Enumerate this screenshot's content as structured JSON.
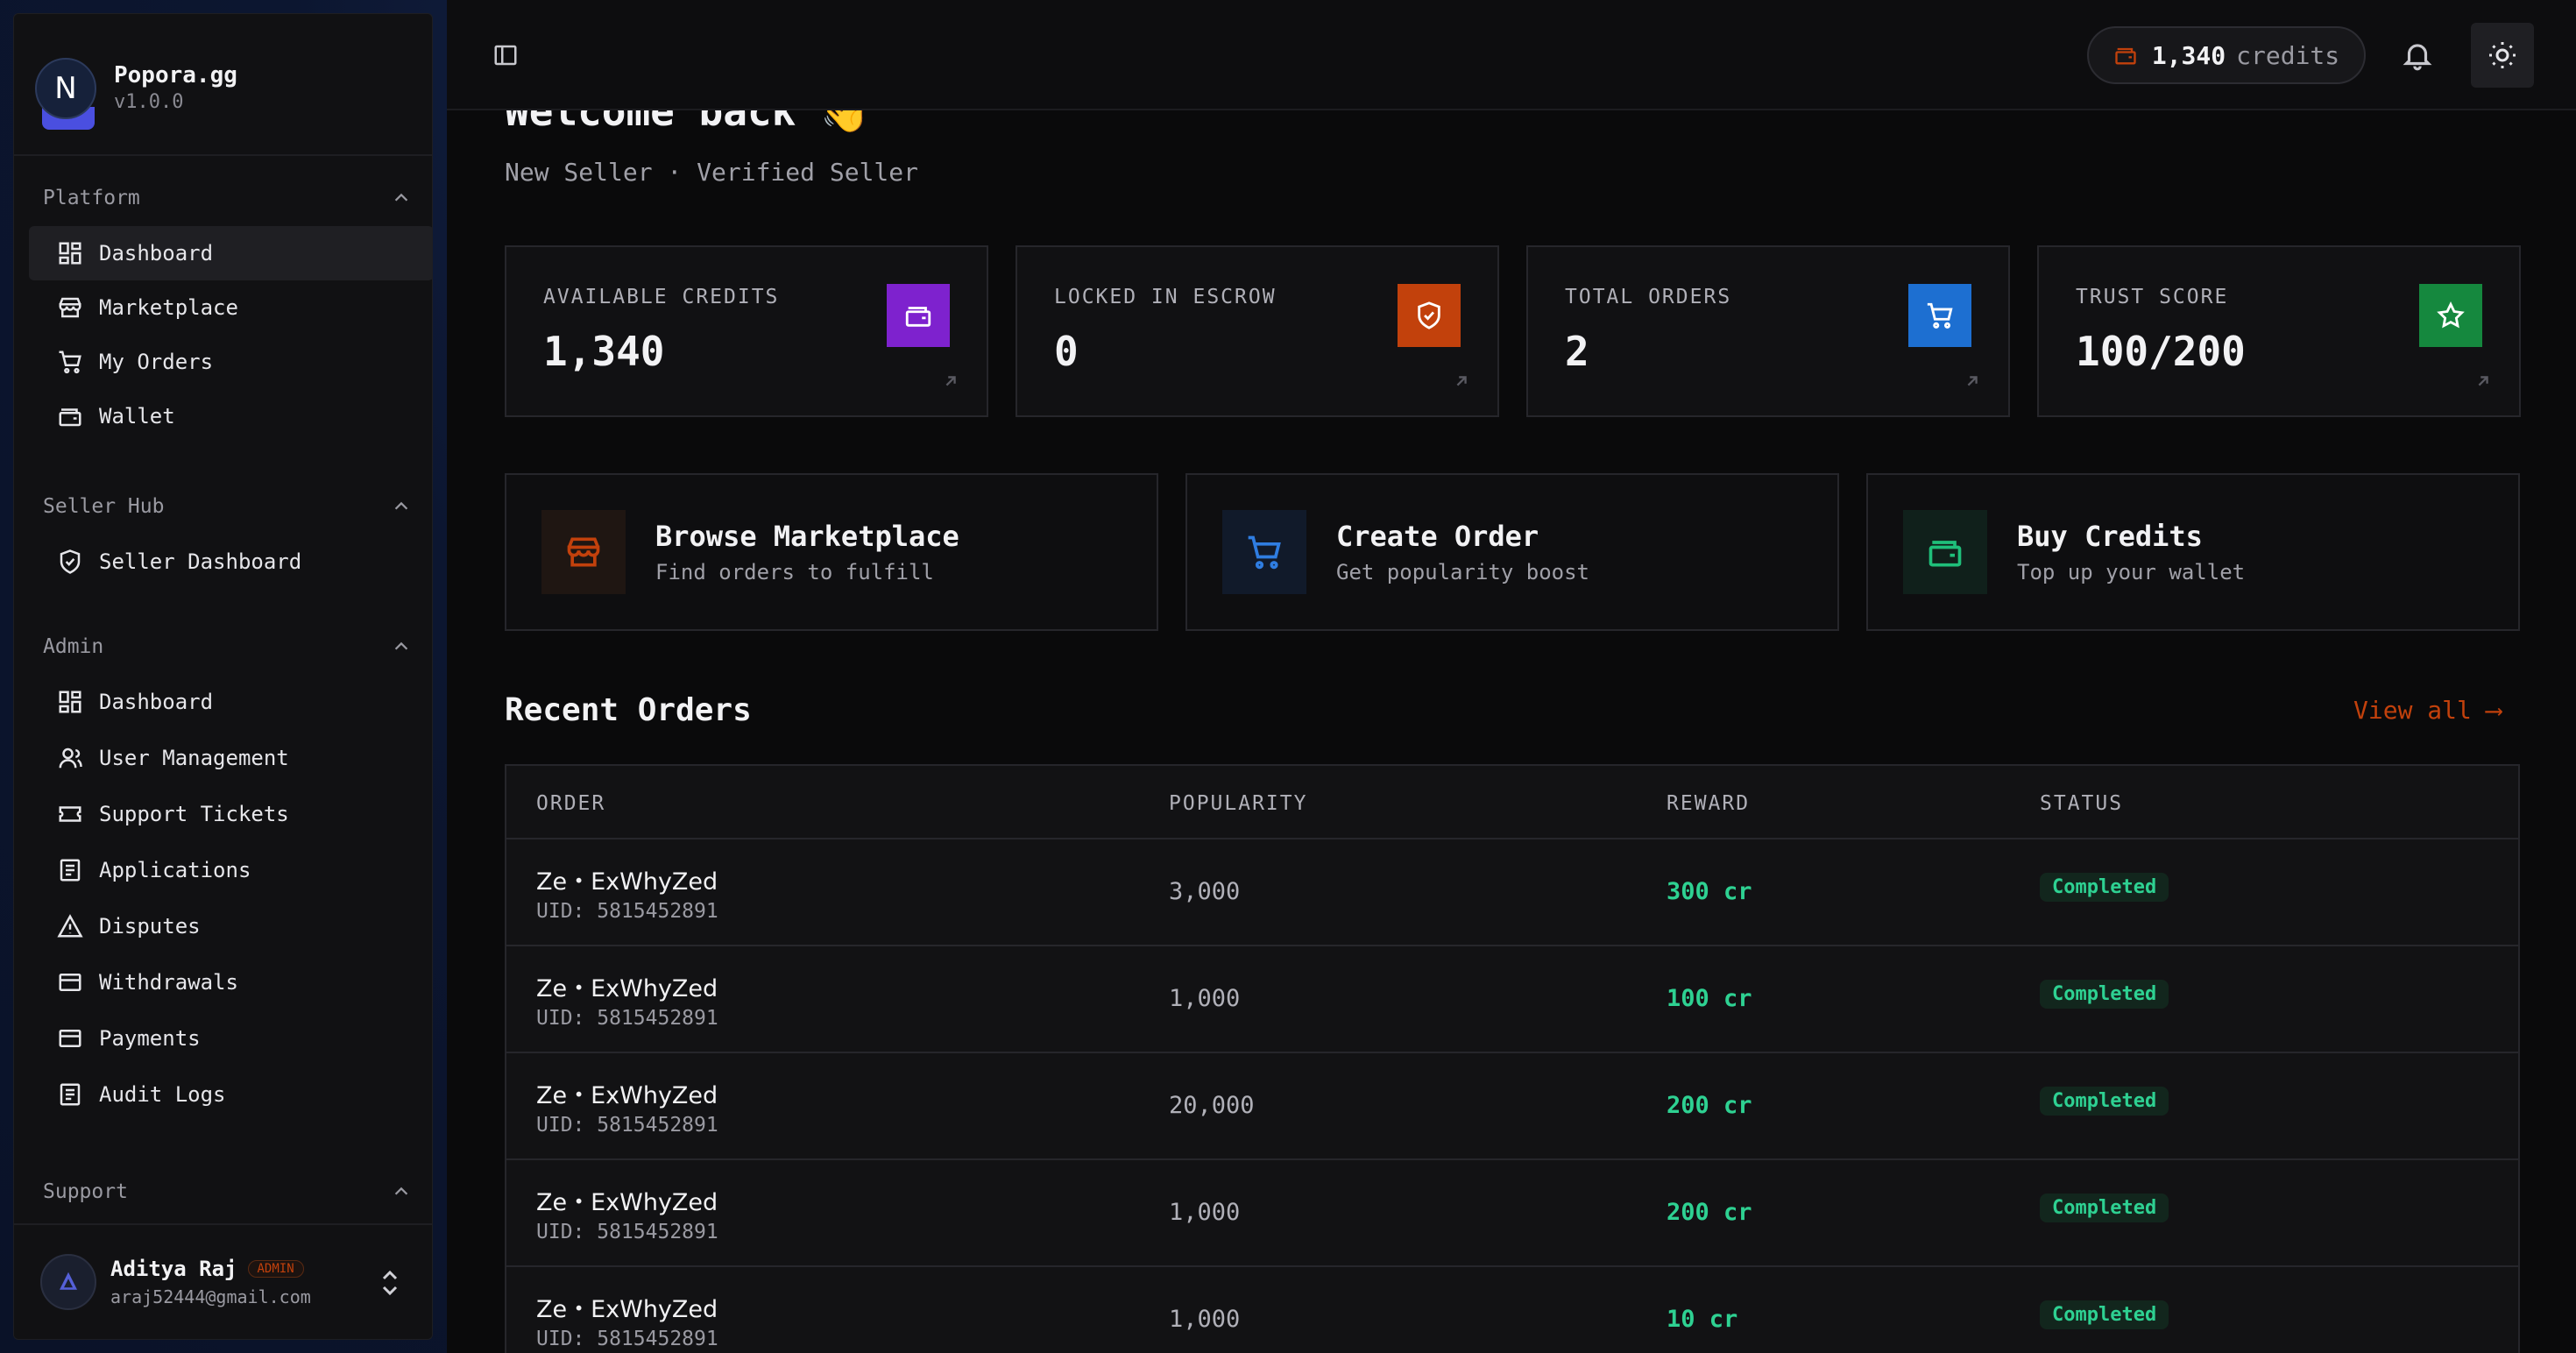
{
  "brand": {
    "initial": "N",
    "name": "Popora.gg",
    "version": "v1.0.0"
  },
  "sidebar": {
    "sections": [
      {
        "title": "Platform",
        "items": [
          {
            "label": "Dashboard",
            "icon": "grid-icon",
            "active": true
          },
          {
            "label": "Marketplace",
            "icon": "store-icon"
          },
          {
            "label": "My Orders",
            "icon": "cart-icon"
          },
          {
            "label": "Wallet",
            "icon": "wallet-icon"
          }
        ]
      },
      {
        "title": "Seller Hub",
        "items": [
          {
            "label": "Seller Dashboard",
            "icon": "shield-check-icon"
          }
        ]
      },
      {
        "title": "Admin",
        "items": [
          {
            "label": "Dashboard",
            "icon": "grid-icon"
          },
          {
            "label": "User Management",
            "icon": "users-icon"
          },
          {
            "label": "Support Tickets",
            "icon": "ticket-icon"
          },
          {
            "label": "Applications",
            "icon": "document-icon"
          },
          {
            "label": "Disputes",
            "icon": "alert-triangle-icon"
          },
          {
            "label": "Withdrawals",
            "icon": "credit-card-icon"
          },
          {
            "label": "Payments",
            "icon": "credit-card-icon"
          },
          {
            "label": "Audit Logs",
            "icon": "document-icon"
          }
        ]
      },
      {
        "title": "Support",
        "items": []
      }
    ]
  },
  "user": {
    "name": "Aditya Raj",
    "badge": "ADMIN",
    "email": "araj52444@gmail.com"
  },
  "topbar": {
    "credits_value": "1,340",
    "credits_label": "credits"
  },
  "welcome": {
    "title": "Welcome back 👋",
    "subtitle": "New Seller · Verified Seller"
  },
  "stats": [
    {
      "label": "AVAILABLE CREDITS",
      "value": "1,340",
      "icon": "wallet-icon",
      "color": "#7e22ce"
    },
    {
      "label": "LOCKED IN ESCROW",
      "value": "0",
      "icon": "shield-check-icon",
      "color": "#c2410c"
    },
    {
      "label": "TOTAL ORDERS",
      "value": "2",
      "icon": "cart-icon",
      "color": "#1d6fd1"
    },
    {
      "label": "TRUST SCORE",
      "value": "100/200",
      "icon": "star-icon",
      "color": "#15883e"
    }
  ],
  "actions": [
    {
      "title": "Browse Marketplace",
      "subtitle": "Find orders to fulfill",
      "icon": "store-icon",
      "color": "#c2410c"
    },
    {
      "title": "Create Order",
      "subtitle": "Get popularity boost",
      "icon": "cart-icon",
      "color": "#2f7de1"
    },
    {
      "title": "Buy Credits",
      "subtitle": "Top up your wallet",
      "icon": "wallet-icon",
      "color": "#1fbf7a"
    }
  ],
  "recent": {
    "title": "Recent Orders",
    "view_all": "View all ⟶",
    "columns": [
      "ORDER",
      "POPULARITY",
      "REWARD",
      "STATUS"
    ],
    "rows": [
      {
        "name": "Ze・ExWhyZed",
        "uid": "UID: 5815452891",
        "popularity": "3,000",
        "reward": "300 cr",
        "status": "Completed"
      },
      {
        "name": "Ze・ExWhyZed",
        "uid": "UID: 5815452891",
        "popularity": "1,000",
        "reward": "100 cr",
        "status": "Completed"
      },
      {
        "name": "Ze・ExWhyZed",
        "uid": "UID: 5815452891",
        "popularity": "20,000",
        "reward": "200 cr",
        "status": "Completed"
      },
      {
        "name": "Ze・ExWhyZed",
        "uid": "UID: 5815452891",
        "popularity": "1,000",
        "reward": "200 cr",
        "status": "Completed"
      },
      {
        "name": "Ze・ExWhyZed",
        "uid": "UID: 5815452891",
        "popularity": "1,000",
        "reward": "10 cr",
        "status": "Completed"
      }
    ]
  }
}
